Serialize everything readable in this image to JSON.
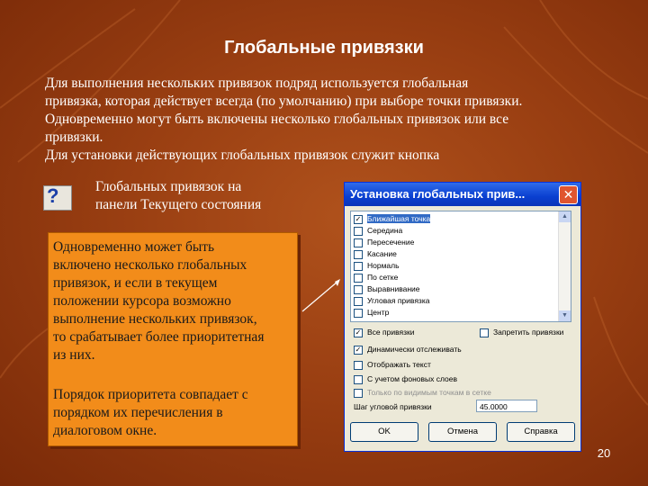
{
  "slide": {
    "title": "Глобальные привязки",
    "body_lines": [
      "Для выполнения нескольких привязок подряд используется глобальная",
      "привязка, которая действует всегда (по умолчанию) при выборе точки привязки.",
      "Одновременно могут быть включены несколько глобальных привязок или все",
      "привязки.",
      "Для установки действующих глобальных привязок служит кнопка"
    ],
    "icon_caption_1": "Глобальных привязок на",
    "icon_caption_2": "панели Текущего состояния",
    "box_p1": [
      "Одновременно может быть",
      "включено несколько глобальных",
      "привязок, и если в текущем",
      "положении курсора возможно",
      "выполнение нескольких привязок,",
      "то срабатывает более приоритетная",
      "из них."
    ],
    "box_p2": [
      "Порядок приоритета совпадает с",
      "порядком их перечисления в",
      "диалоговом окне."
    ],
    "page_number": "20"
  },
  "dialog": {
    "title": "Установка глобальных прив...",
    "close_glyph": "✕",
    "snaps": [
      {
        "label": "Ближайшая точка",
        "checked": true,
        "selected": true
      },
      {
        "label": "Середина",
        "checked": false
      },
      {
        "label": "Пересечение",
        "checked": false
      },
      {
        "label": "Касание",
        "checked": false
      },
      {
        "label": "Нормаль",
        "checked": false
      },
      {
        "label": "По сетке",
        "checked": false
      },
      {
        "label": "Выравнивание",
        "checked": false
      },
      {
        "label": "Угловая привязка",
        "checked": false
      },
      {
        "label": "Центр",
        "checked": false
      }
    ],
    "all_snaps": "Все привязки",
    "disable_snaps": "Запретить привязки",
    "dynamic_tracking": "Динамически отслеживать",
    "show_text": "Отображать текст",
    "background_layers": "С учетом фоновых слоев",
    "current_view_only": "Только по видимым точкам в сетке",
    "angle_step_label": "Шаг угловой привязки",
    "angle_step_value": "45.0000",
    "ok": "OK",
    "cancel": "Отмена",
    "help": "Справка"
  },
  "colors": {
    "background": "#9a3f12",
    "callout": "#f28c1a",
    "titlebar": "#0a3fd0"
  }
}
